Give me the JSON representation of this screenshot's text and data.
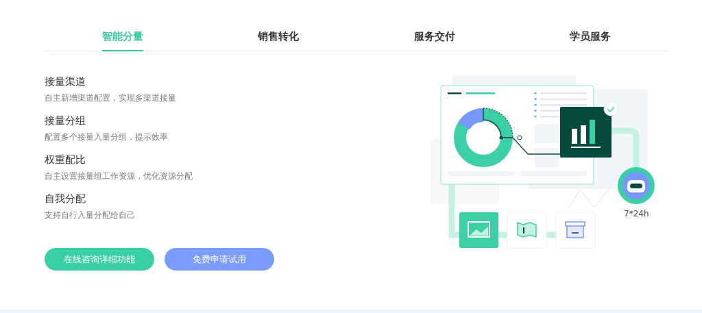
{
  "tabs": [
    {
      "label": "智能分量",
      "selected": true
    },
    {
      "label": "销售转化",
      "selected": false
    },
    {
      "label": "服务交付",
      "selected": false
    },
    {
      "label": "学员服务",
      "selected": false
    }
  ],
  "features": [
    {
      "title": "接量渠道",
      "description": "自主新增渠道配置，实现多渠道接量"
    },
    {
      "title": "接量分组",
      "description": "配置多个接量入量分组，提示效率"
    },
    {
      "title": "权重配比",
      "description": "自主设置接量组工作资源，优化资源分配"
    },
    {
      "title": "自我分配",
      "description": "支持自行入量分配给自己"
    }
  ],
  "buttons": [
    {
      "label": "在线咨询详细功能",
      "kind": "primary"
    },
    {
      "label": "免费申请试用",
      "kind": "secondary"
    }
  ],
  "illustration": {
    "service_label": "7*24h"
  }
}
